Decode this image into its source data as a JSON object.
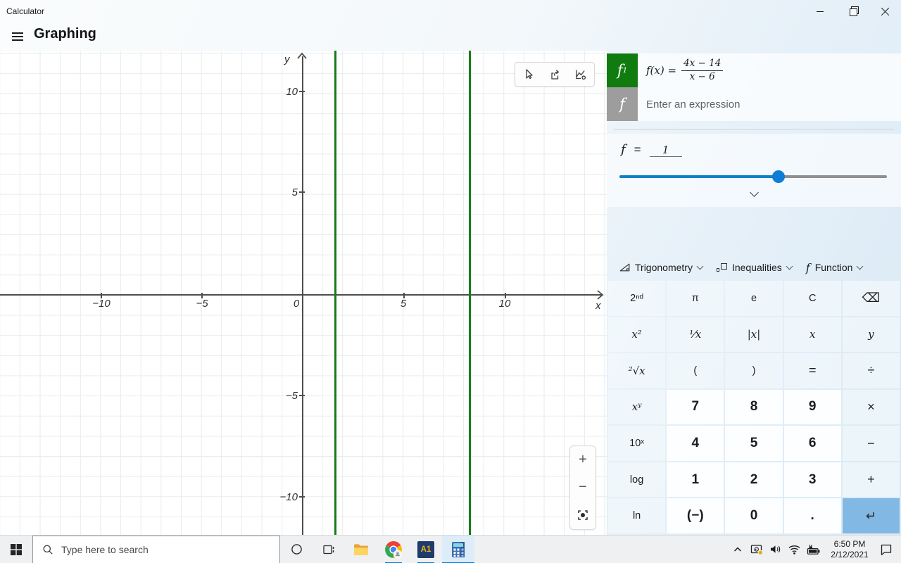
{
  "window": {
    "title": "Calculator"
  },
  "nav": {
    "title": "Graphing"
  },
  "colors": {
    "accent": "#0078d7",
    "function_green": "#107c10",
    "enter_key": "#81b9e4",
    "slider_blue": "#0d80cb",
    "plot_line_green": "#177c17"
  },
  "graph": {
    "x_axis_label": "x",
    "y_axis_label": "y",
    "x_ticks": [
      {
        "label": "−10"
      },
      {
        "label": "−5"
      },
      {
        "label": "0"
      },
      {
        "label": "5"
      },
      {
        "label": "10"
      }
    ],
    "y_ticks": [
      {
        "label": "10"
      },
      {
        "label": "5"
      },
      {
        "label": "−5"
      },
      {
        "label": "−10"
      }
    ]
  },
  "chart_data": {
    "type": "line",
    "title": "",
    "xlabel": "x",
    "ylabel": "y",
    "xlim": [
      -15,
      15
    ],
    "ylim": [
      -11.9,
      12.1
    ],
    "grid": true,
    "x_tick_labels": [
      "−10",
      "−5",
      "0",
      "5",
      "10"
    ],
    "y_tick_labels": [
      "10",
      "5",
      "−5",
      "−10"
    ],
    "series": [
      {
        "name": "f1",
        "expression": "f(x) = (4x − 14)/(x − 6)",
        "color": "#107c17",
        "rendered_as": "two full-height vertical green line branches",
        "vertical_lines_x": [
          1.65,
          8.35
        ]
      }
    ],
    "legend_position": "none"
  },
  "function_list": {
    "f1": {
      "badge": "f",
      "badge_sub": "1",
      "lhs": "f(x) =",
      "numerator": "4x − 14",
      "denominator": "x − 6"
    },
    "new": {
      "badge": "f",
      "placeholder": "Enter an expression"
    }
  },
  "slider": {
    "variable": "f",
    "equals": "=",
    "value": "1",
    "percent": 59.5
  },
  "graph_tools": {
    "zoom_in": "+",
    "zoom_out": "−"
  },
  "keypad": {
    "menus": [
      {
        "label": "Trigonometry"
      },
      {
        "label": "Inequalities"
      },
      {
        "label": "Function"
      }
    ],
    "keys": [
      "2ⁿᵈ",
      "π",
      "e",
      "C",
      "⌫",
      "x²",
      "⅟x",
      "|x|",
      "x",
      "y",
      "²√x",
      "(",
      ")",
      "=",
      "÷",
      "xʸ",
      "7",
      "8",
      "9",
      "×",
      "10ˣ",
      "4",
      "5",
      "6",
      "−",
      "log",
      "1",
      "2",
      "3",
      "+",
      "ln",
      "(−)",
      "0",
      ".",
      "↵"
    ]
  },
  "taskbar": {
    "search": {
      "placeholder": "Type here to search"
    },
    "apps": {
      "a1_label": "A1"
    },
    "tray": {
      "time": "6:50 PM",
      "date": "2/12/2021"
    }
  }
}
